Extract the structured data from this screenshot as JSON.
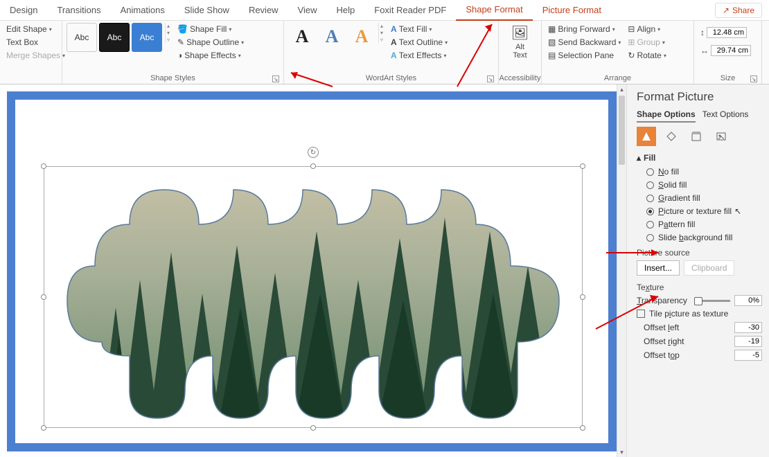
{
  "tabs": {
    "design": "Design",
    "transitions": "Transitions",
    "animations": "Animations",
    "slideshow": "Slide Show",
    "review": "Review",
    "view": "View",
    "help": "Help",
    "foxit": "Foxit Reader PDF",
    "shapeformat": "Shape Format",
    "pictureformat": "Picture Format",
    "share": "Share"
  },
  "ribbon": {
    "insert": {
      "edit_shape": "Edit Shape",
      "text_box": "Text Box",
      "merge": "Merge Shapes"
    },
    "shape_styles": {
      "label": "Shape Styles",
      "swatch": "Abc",
      "fill": "Shape Fill",
      "outline": "Shape Outline",
      "effects": "Shape Effects"
    },
    "wordart": {
      "label": "WordArt Styles",
      "text_fill": "Text Fill",
      "text_outline": "Text Outline",
      "text_effects": "Text Effects"
    },
    "accessibility": {
      "label": "Accessibility",
      "alt": "Alt\nText"
    },
    "arrange": {
      "label": "Arrange",
      "bring": "Bring Forward",
      "send": "Send Backward",
      "selection": "Selection Pane",
      "align": "Align",
      "group": "Group",
      "rotate": "Rotate"
    },
    "size": {
      "label": "Size",
      "height": "12.48 cm",
      "width": "29.74 cm"
    }
  },
  "pane": {
    "title": "Format Picture",
    "shape_options": "Shape Options",
    "text_options": "Text Options",
    "fill": "Fill",
    "no_fill": "No fill",
    "solid_fill": "Solid fill",
    "gradient_fill": "Gradient fill",
    "picture_fill": "Picture or texture fill",
    "pattern_fill": "Pattern fill",
    "slide_bg_fill": "Slide background fill",
    "picture_source": "Picture source",
    "insert": "Insert...",
    "clipboard": "Clipboard",
    "texture": "Texture",
    "transparency": "Transparency",
    "transparency_val": "0%",
    "tile": "Tile picture as texture",
    "offset_left": "Offset left",
    "offset_left_v": "-30",
    "offset_right": "Offset right",
    "offset_right_v": "-19",
    "offset_top": "Offset top",
    "offset_top_v": "-5"
  }
}
